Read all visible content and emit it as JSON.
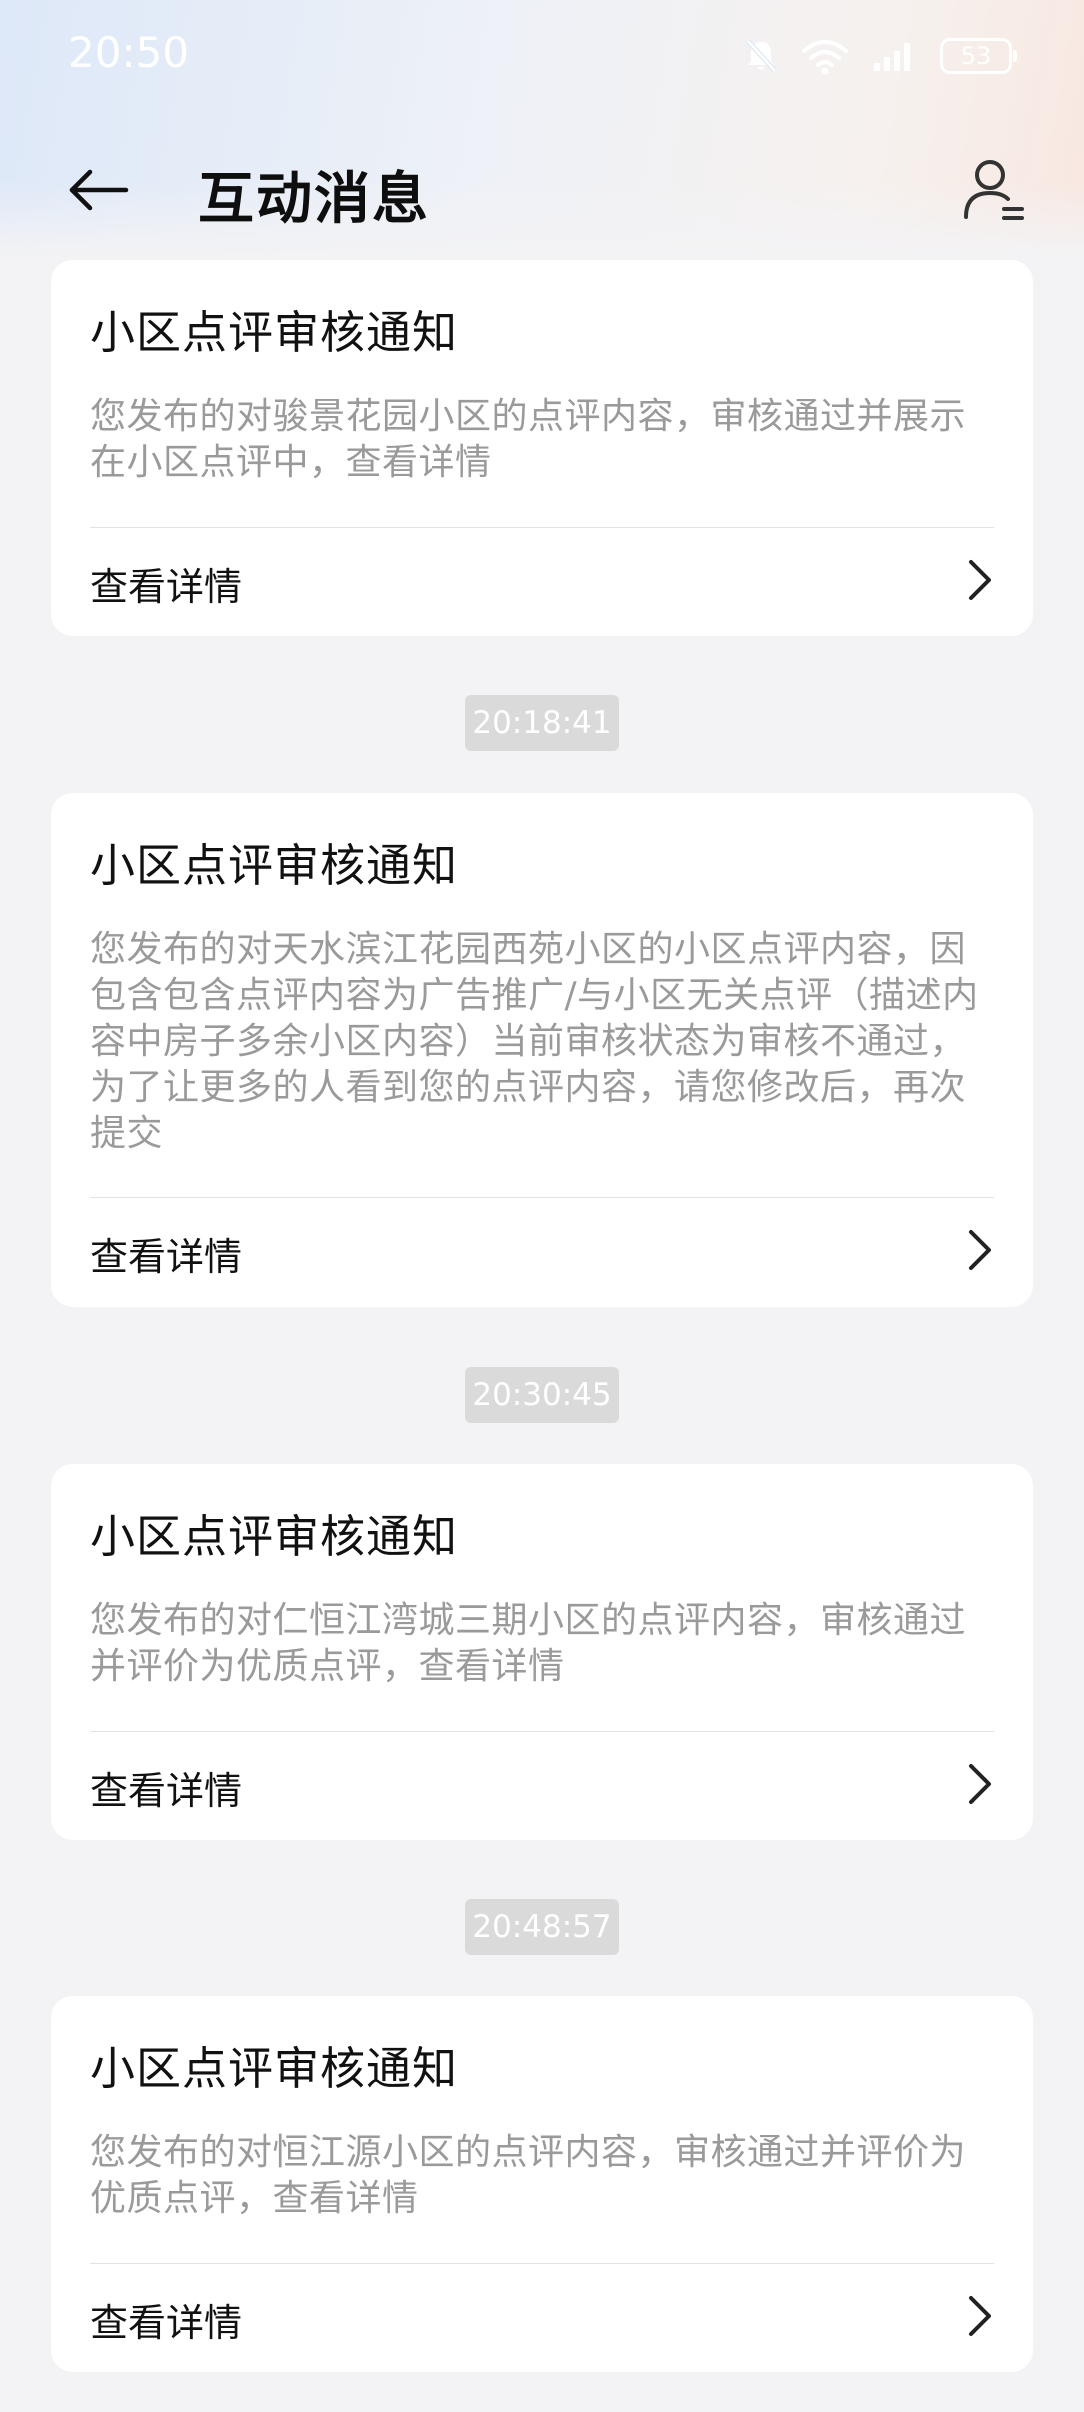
{
  "status_bar": {
    "time": "20:50",
    "battery": "53",
    "icons": [
      "bell-muted-icon",
      "wifi-icon",
      "signal-icon",
      "battery-icon"
    ]
  },
  "nav": {
    "title": "互动消息",
    "back_icon": "arrow-left-icon",
    "profile_icon": "user-settings-icon"
  },
  "messages": [
    {
      "title": "小区点评审核通知",
      "body": "您发布的对骏景花园小区的点评内容，审核通过并展示在小区点评中，查看详情",
      "action": "查看详情"
    },
    {
      "timestamp": "20:18:41",
      "title": "小区点评审核通知",
      "body": "您发布的对天水滨江花园西苑小区的小区点评内容，因包含包含点评内容为广告推广/与小区无关点评（描述内容中房子多余小区内容）当前审核状态为审核不通过，为了让更多的人看到您的点评内容，请您修改后，再次提交",
      "action": "查看详情"
    },
    {
      "timestamp": "20:30:45",
      "title": "小区点评审核通知",
      "body": "您发布的对仁恒江湾城三期小区的点评内容，审核通过并评价为优质点评，查看详情",
      "action": "查看详情"
    },
    {
      "timestamp": "20:48:57",
      "title": "小区点评审核通知",
      "body": "您发布的对恒江源小区的点评内容，审核通过并评价为优质点评，查看详情",
      "action": "查看详情"
    }
  ],
  "colors": {
    "background": "#f3f3f5",
    "card": "#ffffff",
    "body_text": "#9a9a9a",
    "badge": "#dadada"
  }
}
